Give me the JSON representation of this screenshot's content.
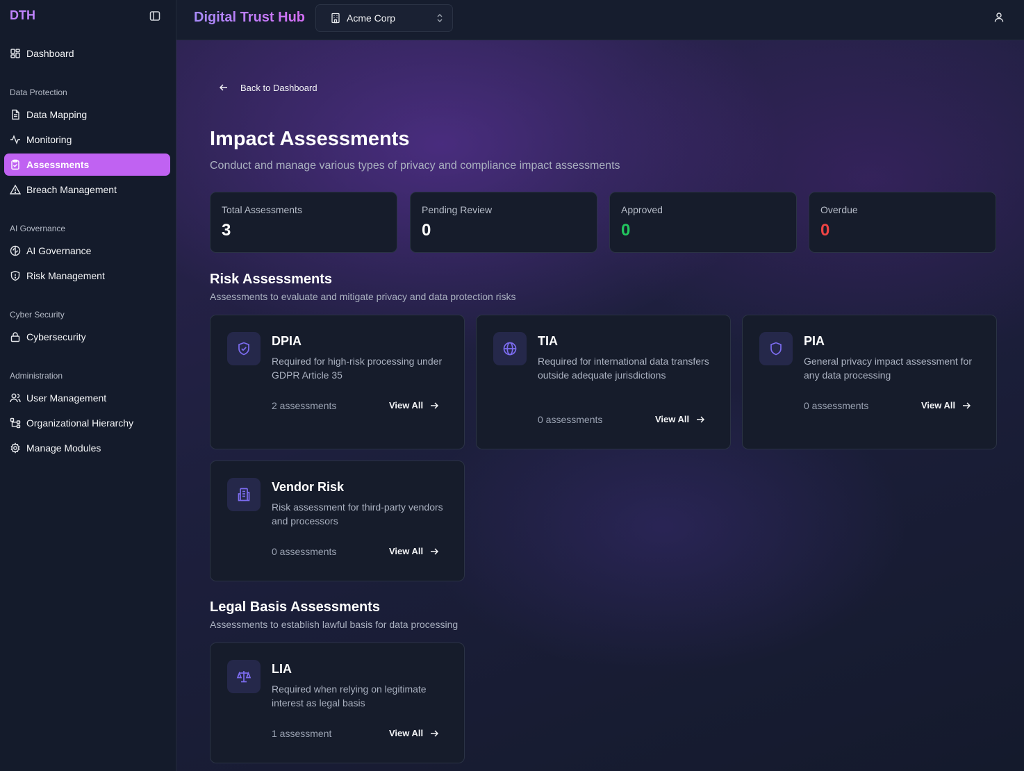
{
  "sidebar": {
    "brand": "DTH",
    "items": {
      "dashboard": "Dashboard",
      "data_mapping": "Data Mapping",
      "monitoring": "Monitoring",
      "assessments": "Assessments",
      "breach_management": "Breach Management",
      "ai_governance": "AI Governance",
      "risk_management": "Risk Management",
      "cybersecurity": "Cybersecurity",
      "user_management": "User Management",
      "org_hierarchy": "Organizational Hierarchy",
      "manage_modules": "Manage Modules"
    },
    "sections": {
      "data_protection": "Data Protection",
      "ai_governance": "AI Governance",
      "cyber_security": "Cyber Security",
      "administration": "Administration"
    },
    "active_color": "#c062f2"
  },
  "header": {
    "app_title": "Digital Trust Hub",
    "org": "Acme Corp"
  },
  "main": {
    "back_label": "Back to Dashboard",
    "title": "Impact Assessments",
    "subtitle": "Conduct and manage various types of privacy and compliance impact assessments",
    "stats": [
      {
        "label": "Total Assessments",
        "value": "3",
        "color": "#ffffff"
      },
      {
        "label": "Pending Review",
        "value": "0",
        "color": "#ffffff"
      },
      {
        "label": "Approved",
        "value": "0",
        "color": "#22c55e"
      },
      {
        "label": "Overdue",
        "value": "0",
        "color": "#ef4444"
      }
    ],
    "risk_section": {
      "title": "Risk Assessments",
      "subtitle": "Assessments to evaluate and mitigate privacy and data protection risks"
    },
    "legal_section": {
      "title": "Legal Basis Assessments",
      "subtitle": "Assessments to establish lawful basis for data processing"
    },
    "cards": {
      "dpia": {
        "title": "DPIA",
        "desc": "Required for high-risk processing under GDPR Article 35",
        "count": "2 assessments",
        "action": "View All",
        "icon": "shield-check-icon"
      },
      "tia": {
        "title": "TIA",
        "desc": "Required for international data transfers outside adequate jurisdictions",
        "count": "0 assessments",
        "action": "View All",
        "icon": "globe-icon"
      },
      "pia": {
        "title": "PIA",
        "desc": "General privacy impact assessment for any data processing",
        "count": "0 assessments",
        "action": "View All",
        "icon": "shield-icon"
      },
      "vendor": {
        "title": "Vendor Risk",
        "desc": "Risk assessment for third-party vendors and processors",
        "count": "0 assessments",
        "action": "View All",
        "icon": "building-icon"
      },
      "lia": {
        "title": "LIA",
        "desc": "Required when relying on legitimate interest as legal basis",
        "count": "1 assessment",
        "action": "View All",
        "icon": "scale-icon"
      }
    },
    "accent_icon_color": "#7c6cf0"
  }
}
